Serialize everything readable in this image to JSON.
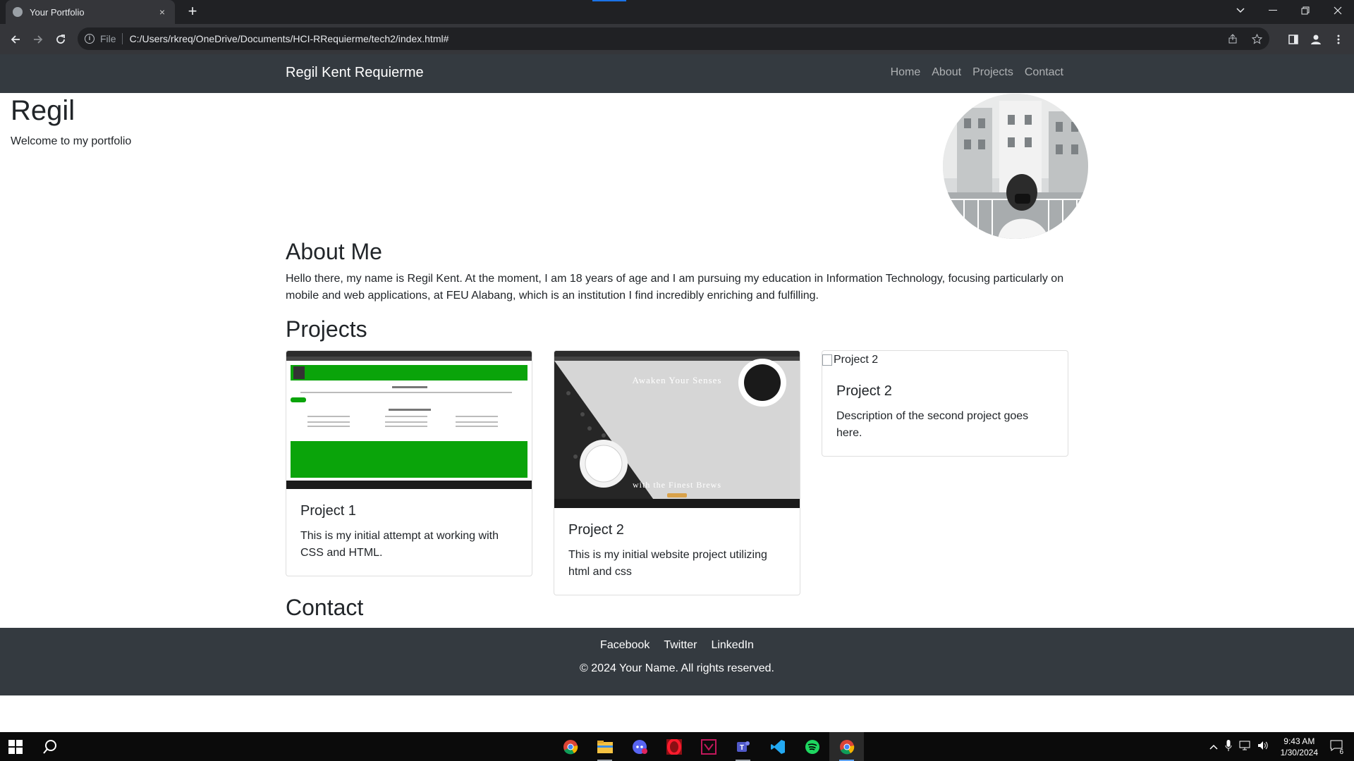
{
  "browser": {
    "tab_title": "Your Portfolio",
    "tab_close": "×",
    "new_tab": "+",
    "url_scheme": "File",
    "url": "C:/Users/rkreq/OneDrive/Documents/HCI-RRequierme/tech2/index.html#"
  },
  "site": {
    "brand": "Regil Kent Requierme",
    "nav": [
      "Home",
      "About",
      "Projects",
      "Contact"
    ],
    "hero_title": "Regil",
    "hero_subtitle": "Welcome to my portfolio",
    "about_heading": "About Me",
    "about_text": "Hello there, my name is Regil Kent. At the moment, I am 18 years of age and I am pursuing my education in Information Technology, focusing particularly on mobile and web applications, at FEU Alabang, which is an institution I find incredibly enriching and fulfilling.",
    "projects_heading": "Projects",
    "projects": [
      {
        "title": "Project 1",
        "text": "This is my initial attempt at working with CSS and HTML."
      },
      {
        "title": "Project 2",
        "text": "This is my initial website project utilizing html and css",
        "img_text_top": "Awaken Your Senses",
        "img_text_bottom": "with the Finest Brews"
      },
      {
        "title": "Project 2",
        "text": "Description of the second project goes here.",
        "img_alt": "Project 2"
      }
    ],
    "contact_heading": "Contact",
    "footer_links": [
      "Facebook",
      "Twitter",
      "LinkedIn"
    ],
    "copyright": "© 2024 Your Name. All rights reserved."
  },
  "taskbar": {
    "time": "9:43 AM",
    "date": "1/30/2024",
    "notification_count": "6"
  }
}
